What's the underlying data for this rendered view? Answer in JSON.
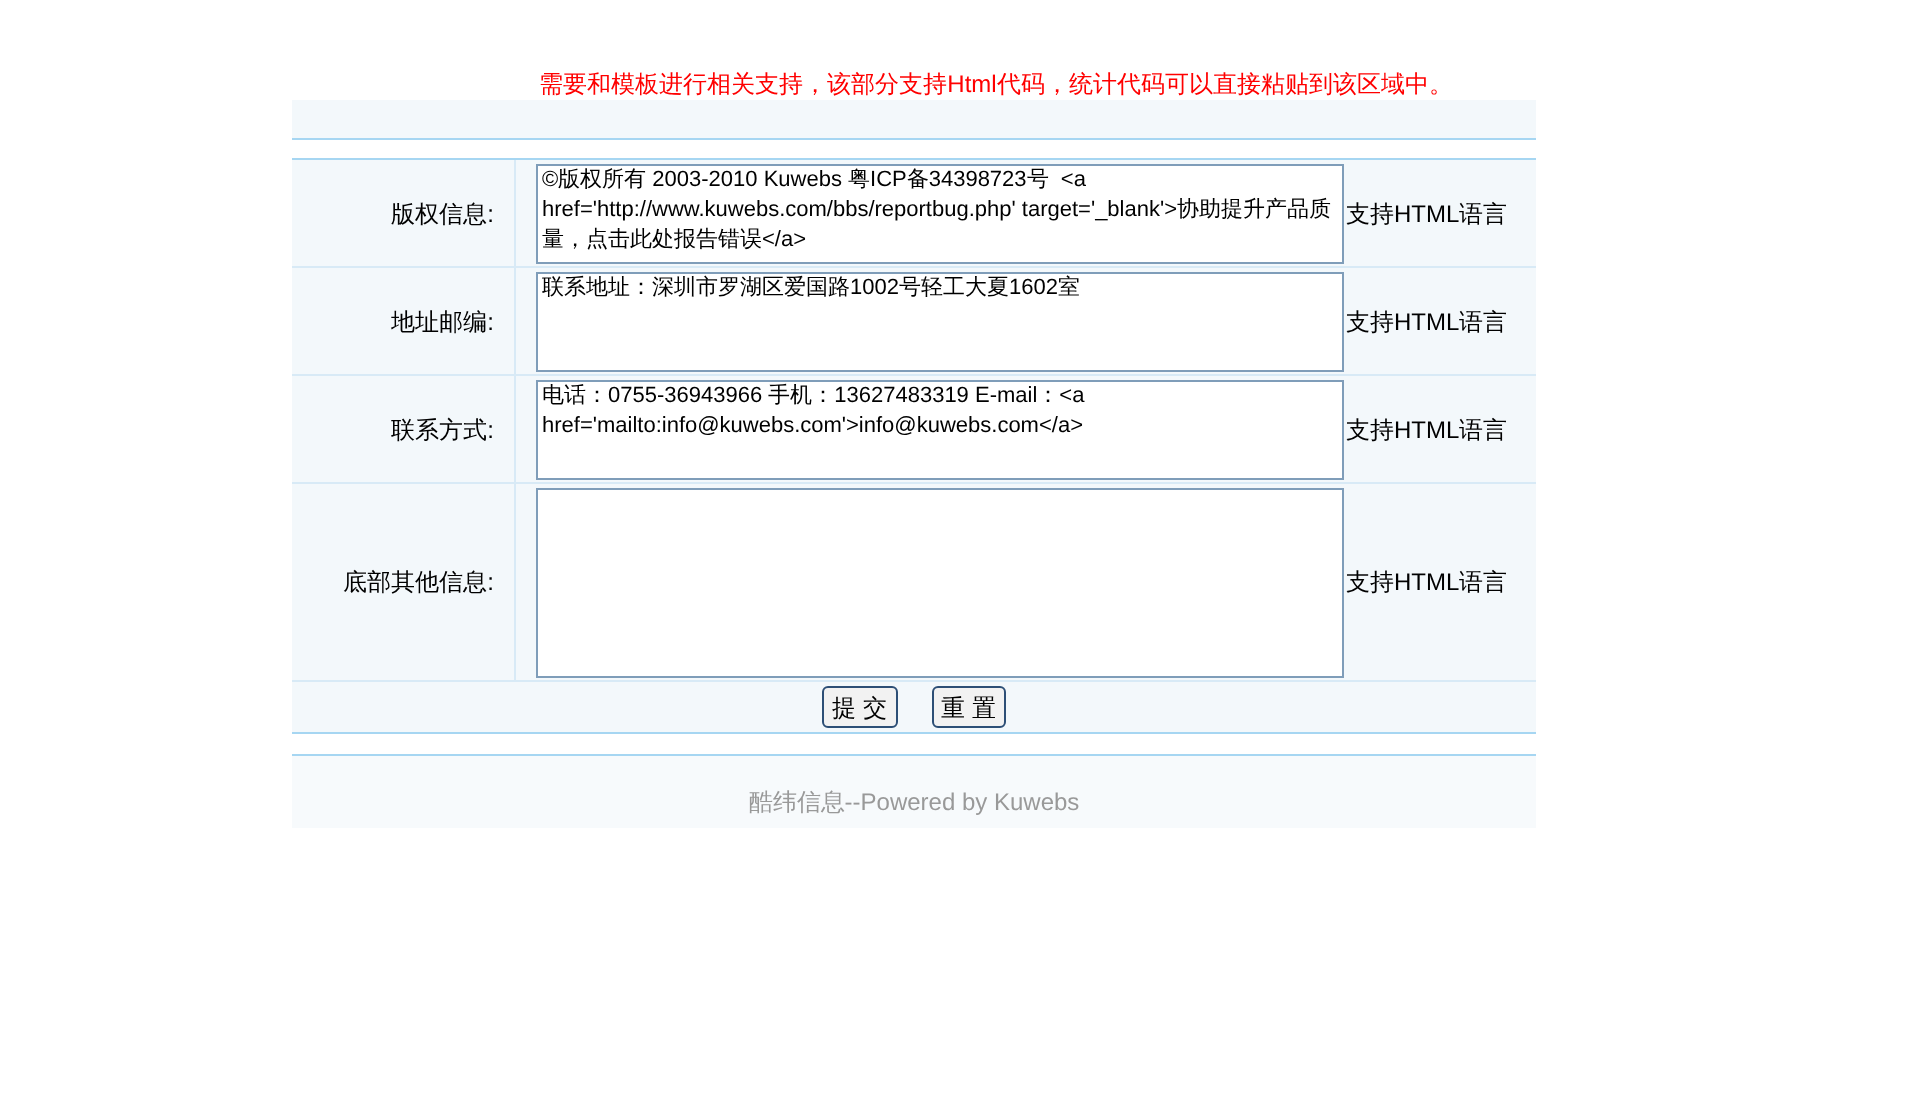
{
  "notice": "需要和模板进行相关支持，该部分支持Html代码，统计代码可以直接粘贴到该区域中。",
  "rows": [
    {
      "label": "版权信息:",
      "value": "©版权所有 2003-2010 Kuwebs 粤ICP备34398723号  <a href='http://www.kuwebs.com/bbs/reportbug.php' target='_blank'>协助提升产品质量，点击此处报告错误</a>",
      "note": "支持HTML语言",
      "tall": false
    },
    {
      "label": "地址邮编:",
      "value": "联系地址：深圳市罗湖区爱国路1002号轻工大夏1602室",
      "note": "支持HTML语言",
      "tall": false
    },
    {
      "label": "联系方式:",
      "value": "电话：0755-36943966 手机：13627483319 E-mail：<a href='mailto:info@kuwebs.com'>info@kuwebs.com</a>",
      "note": "支持HTML语言",
      "tall": false
    },
    {
      "label": "底部其他信息:",
      "value": "",
      "note": "支持HTML语言",
      "tall": true
    }
  ],
  "buttons": [
    "提 交",
    "重 置"
  ],
  "footer": "酷纬信息--Powered by Kuwebs"
}
